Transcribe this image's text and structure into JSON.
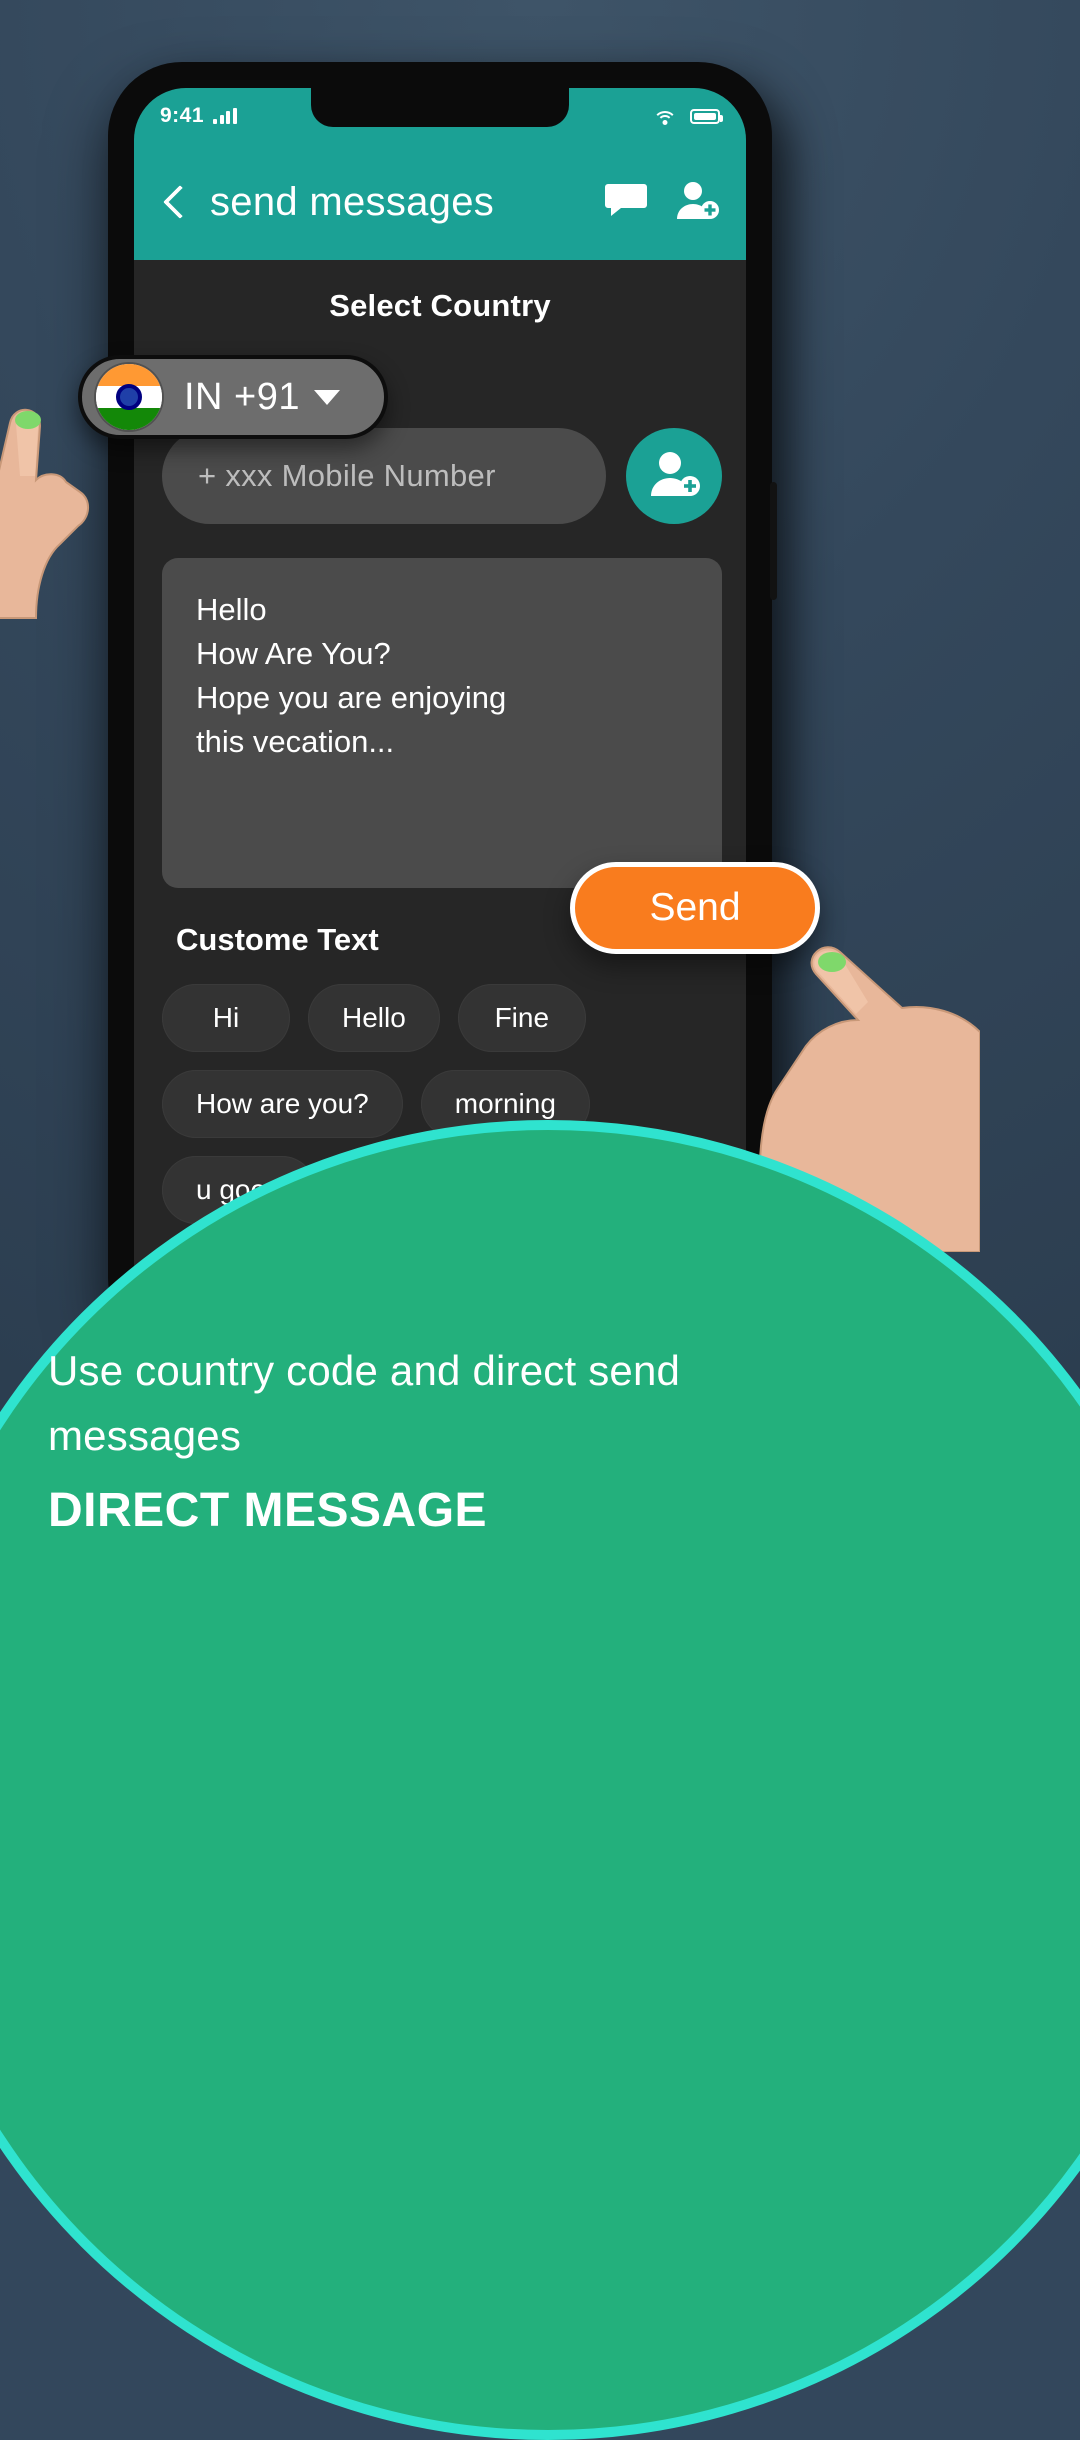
{
  "statusbar": {
    "time": "9:41",
    "signal_icon": "signal-bars-icon",
    "wifi_icon": "wifi-icon",
    "battery_icon": "battery-icon"
  },
  "appbar": {
    "back_icon": "back-chevron-icon",
    "title": "send messages",
    "actions": [
      {
        "icon": "chat-bubble-icon"
      },
      {
        "icon": "add-contact-icon"
      }
    ]
  },
  "screen": {
    "select_country_label": "Select Country",
    "country_selector": {
      "flag_icon": "india-flag-icon",
      "code": "IN +91",
      "caret_icon": "chevron-down-icon"
    },
    "number_field": {
      "placeholder": "+ xxx Mobile Number",
      "value": ""
    },
    "contact_fab_icon": "add-person-icon",
    "message": {
      "lines": [
        "Hello",
        "How Are You?",
        "Hope you are enjoying",
        "this vecation..."
      ]
    },
    "send_button_label": "Send",
    "custom_text_label": "Custome Text",
    "chips": [
      {
        "label": "Hi"
      },
      {
        "label": "Hello"
      },
      {
        "label": "Fine"
      },
      {
        "label": "How are you?"
      },
      {
        "label": "morning"
      },
      {
        "label": "u good"
      }
    ]
  },
  "promo": {
    "subtitle": "Use country code and direct send messages",
    "title": "DIRECT MESSAGE"
  },
  "colors": {
    "brand_teal": "#1ba195",
    "accent_orange": "#F97C1E",
    "promo_green": "#23b07c",
    "promo_ring": "#2fe3cf",
    "app_background": "#262626",
    "field_grey": "#4b4b4b",
    "page_background": "#33475c"
  }
}
